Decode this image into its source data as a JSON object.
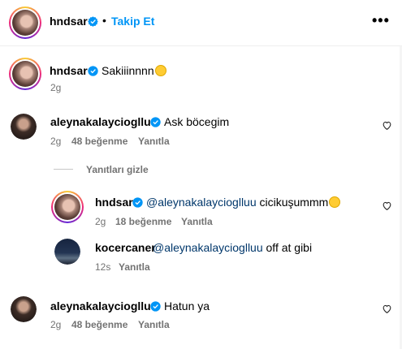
{
  "header": {
    "username": "hndsar",
    "separator": "•",
    "follow_label": "Takip Et",
    "more_label": "•••"
  },
  "caption": {
    "username": "hndsar",
    "text": "Sakiiinnnn",
    "emoji": "😅",
    "time": "2g"
  },
  "comments": [
    {
      "username": "aleynakalaycioglluu",
      "text": "Ask böcegim",
      "time": "2g",
      "likes": "48 beğenme",
      "reply_label": "Yanıtla"
    },
    {
      "username": "aleynakalaycioglluu",
      "text": "Hatun ya",
      "time": "2g",
      "likes": "48 beğenme",
      "reply_label": "Yanıtla"
    }
  ],
  "hide_replies_label": "Yanıtları gizle",
  "replies": [
    {
      "username": "hndsar",
      "mention": "@aleynakalaycioglluu",
      "text": "cicikuşummm",
      "emoji": "😭",
      "time": "2g",
      "likes": "18 beğenme",
      "reply_label": "Yanıtla"
    },
    {
      "username": "kocercaner",
      "mention": "@aleynakalaycioglluu",
      "text": "off at gibi",
      "time": "12s",
      "reply_label": "Yanıtla"
    }
  ],
  "colors": {
    "accent": "#0095f6",
    "verified": "#0095f6",
    "mention": "#00376b",
    "secondary_text": "#737373"
  },
  "icons": {
    "verified": "verified-badge-icon",
    "heart": "heart-outline-icon",
    "more": "more-horizontal-icon"
  }
}
